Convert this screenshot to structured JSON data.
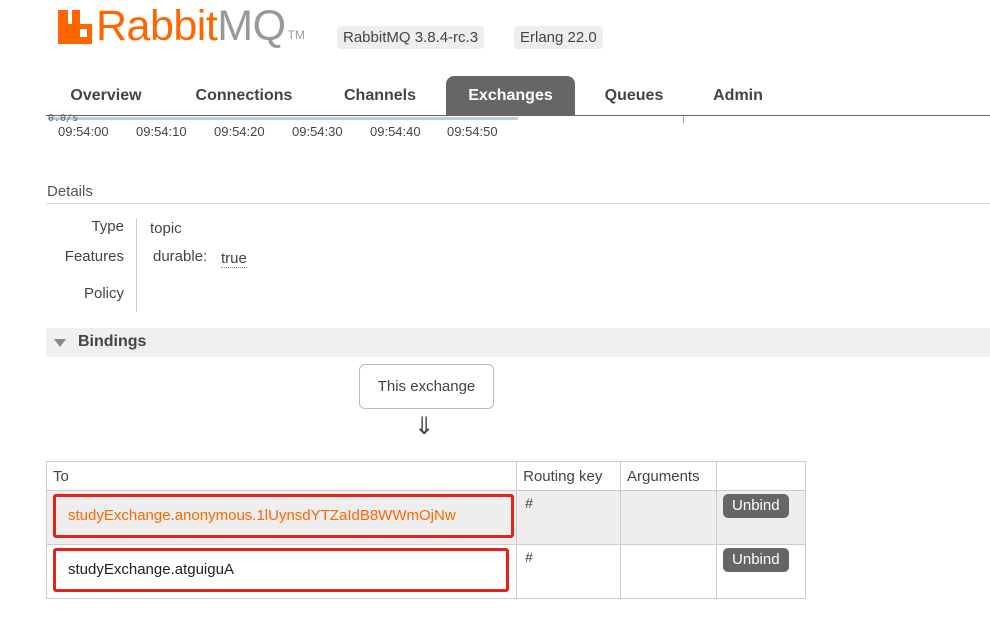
{
  "header": {
    "logo_rabbit": "Rabbit",
    "logo_mq": "MQ",
    "logo_tm": "TM",
    "version_rabbitmq": "RabbitMQ 3.8.4-rc.3",
    "version_erlang": "Erlang 22.0"
  },
  "tabs": [
    {
      "label": "Overview"
    },
    {
      "label": "Connections"
    },
    {
      "label": "Channels"
    },
    {
      "label": "Exchanges",
      "active": true
    },
    {
      "label": "Queues"
    },
    {
      "label": "Admin"
    }
  ],
  "chart": {
    "y_value_label": "0.0/s",
    "x_ticks": [
      "09:54:00",
      "09:54:10",
      "09:54:20",
      "09:54:30",
      "09:54:40",
      "09:54:50"
    ]
  },
  "details": {
    "title": "Details",
    "type_label": "Type",
    "type_value": "topic",
    "features_label": "Features",
    "durable_key": "durable:",
    "durable_value": "true",
    "policy_label": "Policy"
  },
  "bindings": {
    "title": "Bindings",
    "this_exchange": "This exchange",
    "arrow": "⇓",
    "columns": {
      "to": "To",
      "routing_key": "Routing key",
      "arguments": "Arguments"
    },
    "rows": [
      {
        "to": "studyExchange.anonymous.1lUynsdYTZaIdB8WWmOjNw",
        "routing_key": "#",
        "arguments": "",
        "action": "Unbind"
      },
      {
        "to": "studyExchange.atguiguA",
        "routing_key": "#",
        "arguments": "",
        "action": "Unbind"
      }
    ]
  },
  "colors": {
    "brand_orange": "#ff6600",
    "tab_active_bg": "#666666",
    "highlight_red": "#e2231a"
  }
}
